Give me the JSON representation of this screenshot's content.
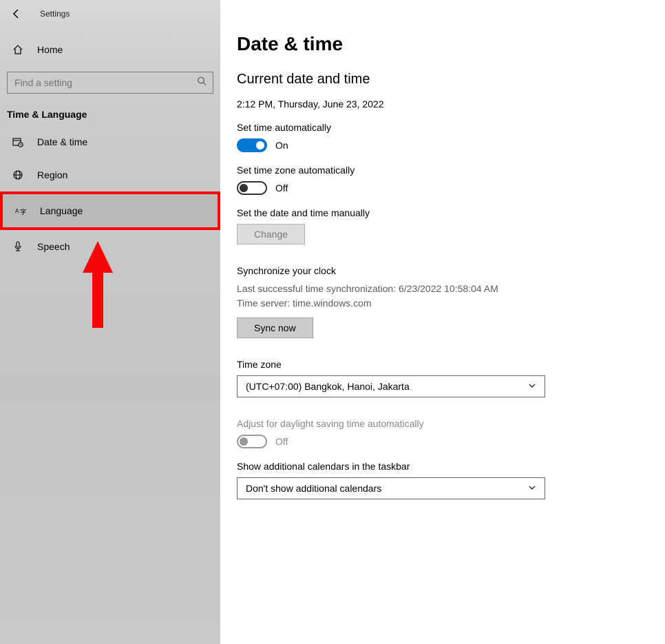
{
  "sidebar": {
    "app_title": "Settings",
    "home_label": "Home",
    "search_placeholder": "Find a setting",
    "section_title": "Time & Language",
    "items": [
      {
        "label": "Date & time"
      },
      {
        "label": "Region"
      },
      {
        "label": "Language"
      },
      {
        "label": "Speech"
      }
    ]
  },
  "main": {
    "title": "Date & time",
    "current_heading": "Current date and time",
    "current_value": "2:12 PM, Thursday, June 23, 2022",
    "set_time_auto_label": "Set time automatically",
    "set_time_auto_state": "On",
    "set_tz_auto_label": "Set time zone automatically",
    "set_tz_auto_state": "Off",
    "set_manual_label": "Set the date and time manually",
    "change_btn": "Change",
    "sync_heading": "Synchronize your clock",
    "sync_last": "Last successful time synchronization: 6/23/2022 10:58:04 AM",
    "sync_server": "Time server: time.windows.com",
    "sync_btn": "Sync now",
    "tz_heading": "Time zone",
    "tz_value": "(UTC+07:00) Bangkok, Hanoi, Jakarta",
    "dst_label": "Adjust for daylight saving time automatically",
    "dst_state": "Off",
    "add_cal_label": "Show additional calendars in the taskbar",
    "add_cal_value": "Don't show additional calendars"
  },
  "annotation": {
    "arrow_color": "#f60606",
    "highlight_color": "#ff0000"
  }
}
